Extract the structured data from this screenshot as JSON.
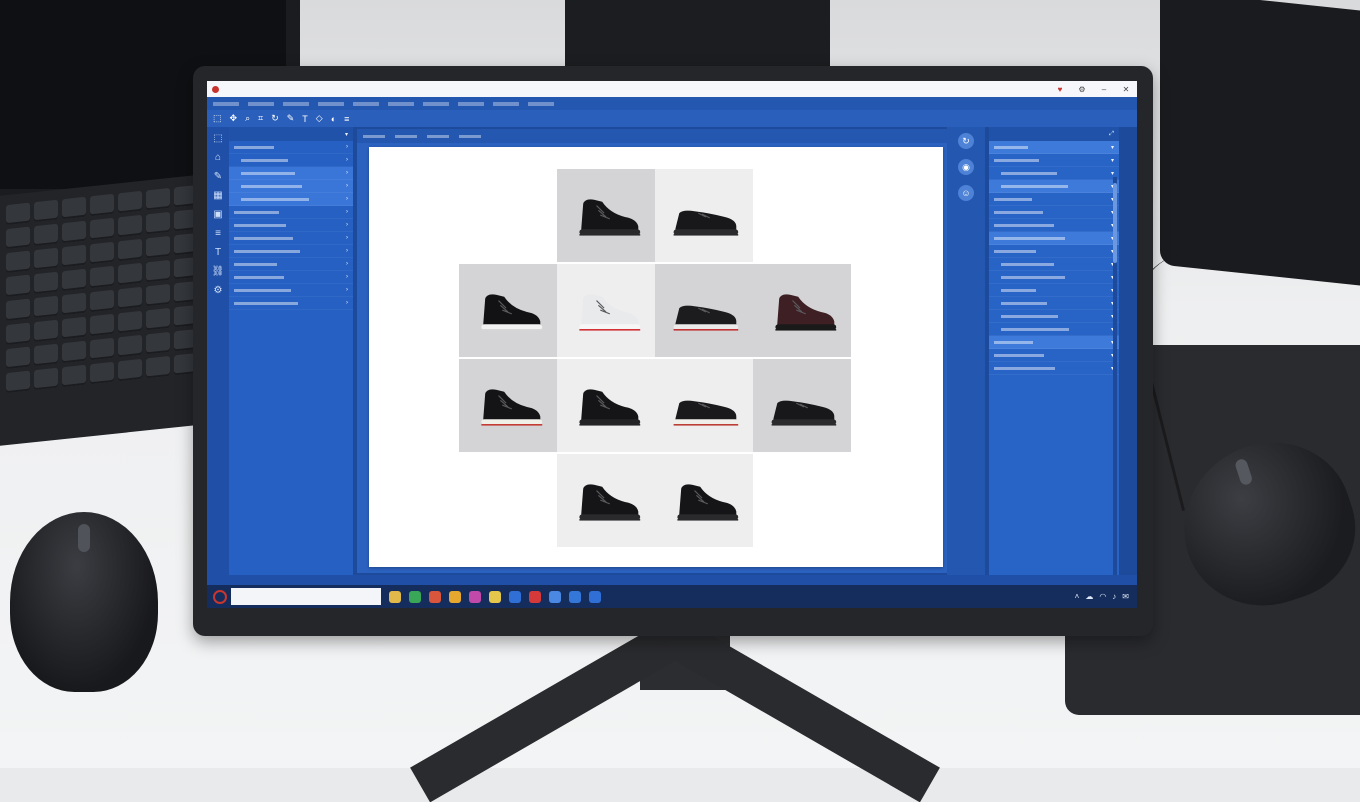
{
  "window": {
    "title": "",
    "controls": [
      "heart-icon",
      "settings-icon",
      "minimize-icon",
      "close-icon"
    ]
  },
  "menu": {
    "items": [
      "",
      "",
      "",
      "",
      "",
      "",
      "",
      "",
      "",
      ""
    ]
  },
  "toolbar": {
    "icons": [
      "select-icon",
      "move-icon",
      "zoom-icon",
      "crop-icon",
      "rotate-icon",
      "brush-icon",
      "text-icon",
      "shape-icon",
      "color-icon",
      "layers-icon"
    ]
  },
  "left_panel": {
    "header": "",
    "items": [
      {
        "label": "",
        "selected": false
      },
      {
        "label": "",
        "selected": false
      },
      {
        "label": "",
        "selected": true
      },
      {
        "label": "",
        "selected": true
      },
      {
        "label": "",
        "selected": true
      },
      {
        "label": "",
        "selected": false
      },
      {
        "label": "",
        "selected": false
      },
      {
        "label": "",
        "selected": false
      },
      {
        "label": "",
        "selected": false
      },
      {
        "label": "",
        "selected": false
      },
      {
        "label": "",
        "selected": false
      },
      {
        "label": "",
        "selected": false
      },
      {
        "label": "",
        "selected": false
      }
    ]
  },
  "doc_tabs": {
    "items": [
      "",
      "",
      "",
      ""
    ]
  },
  "canvas": {
    "tiles": [
      {
        "shoe": "black-high-boot",
        "bg": "gray"
      },
      {
        "shoe": "black-low-shoe",
        "bg": "light"
      },
      {
        "shoe": "black-sneaker-boot",
        "bg": "gray"
      },
      {
        "shoe": "white-sneaker-red-sole",
        "bg": "light"
      },
      {
        "shoe": "black-shoe-red-accent",
        "bg": "gray"
      },
      {
        "shoe": "burgundy-boot",
        "bg": "gray"
      },
      {
        "shoe": "black-boot-red-sole",
        "bg": "gray"
      },
      {
        "shoe": "black-boot",
        "bg": "light"
      },
      {
        "shoe": "black-shoe-white-sole",
        "bg": "light"
      },
      {
        "shoe": "black-low-shoe",
        "bg": "gray"
      },
      {
        "shoe": "black-high-boot",
        "bg": "light"
      },
      {
        "shoe": "black-high-boot",
        "bg": "light"
      }
    ]
  },
  "right_panel": {
    "header": "",
    "items": [
      {
        "label": "",
        "selected": true
      },
      {
        "label": "",
        "selected": false
      },
      {
        "label": "",
        "selected": false
      },
      {
        "label": "",
        "selected": true
      },
      {
        "label": "",
        "selected": false
      },
      {
        "label": "",
        "selected": false
      },
      {
        "label": "",
        "selected": false
      },
      {
        "label": "",
        "selected": true
      },
      {
        "label": "",
        "selected": false
      },
      {
        "label": "",
        "selected": false
      },
      {
        "label": "",
        "selected": false
      },
      {
        "label": "",
        "selected": false
      },
      {
        "label": "",
        "selected": false
      },
      {
        "label": "",
        "selected": false
      },
      {
        "label": "",
        "selected": false
      },
      {
        "label": "",
        "selected": true
      },
      {
        "label": "",
        "selected": false
      },
      {
        "label": "",
        "selected": false
      }
    ]
  },
  "status": {
    "left": "",
    "mid": ""
  },
  "taskbar": {
    "search_placeholder": "",
    "apps": [
      "#e0b94a",
      "#3aa657",
      "#d9553c",
      "#e7a830",
      "#c049a9",
      "#e5c84b",
      "#2f6fd6",
      "#d6393a",
      "#4a88e3",
      "#3477d9",
      "#2f6fd6"
    ]
  },
  "colors": {
    "accent": "#2560c2",
    "panel_dark": "#1f4fa6",
    "taskbar": "#152d5c"
  }
}
